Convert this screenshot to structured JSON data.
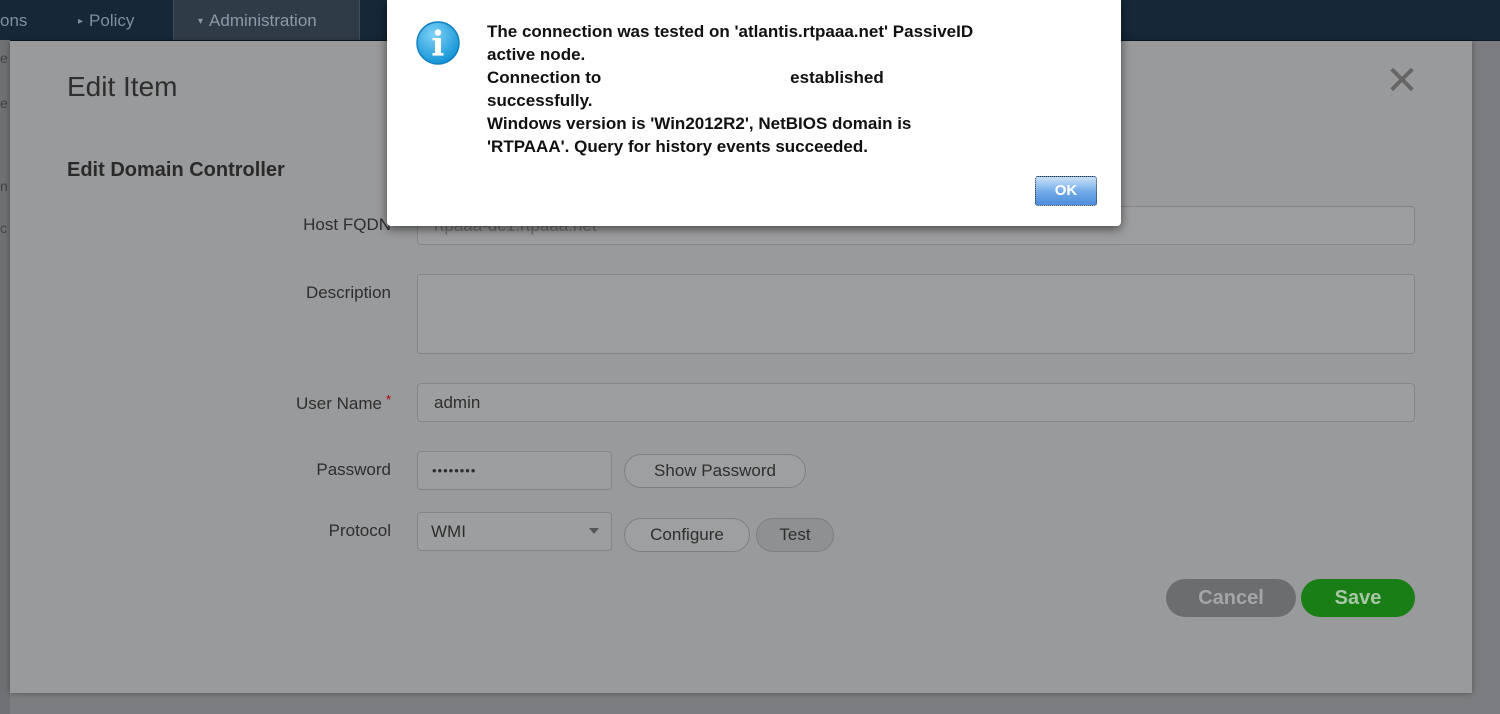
{
  "nav": {
    "items": [
      {
        "label": "ons",
        "caret": ""
      },
      {
        "label": "Policy",
        "caret": "▸"
      },
      {
        "label": "Administration",
        "caret": "▾"
      }
    ]
  },
  "side_letters": [
    "e",
    "e",
    "n",
    "c"
  ],
  "modal": {
    "title": "Edit Item",
    "close_glyph": "✕",
    "section_title": "Edit Domain Controller",
    "fields": {
      "host_fqdn": {
        "label": "Host FQDN",
        "value": "rtpaaa-dc1.rtpaaa.net"
      },
      "description": {
        "label": "Description",
        "value": ""
      },
      "user_name": {
        "label": "User Name",
        "required_mark": "*",
        "value": "admin"
      },
      "password": {
        "label": "Password",
        "value": "••••••••"
      },
      "protocol": {
        "label": "Protocol",
        "value": "WMI"
      }
    },
    "buttons": {
      "show_password": "Show Password",
      "configure": "Configure",
      "test": "Test",
      "cancel": "Cancel",
      "save": "Save"
    }
  },
  "alert": {
    "icon": "info-icon",
    "lines": [
      "The connection was tested on 'atlantis.rtpaaa.net' PassiveID",
      "active node.",
      "Connection to                                        established",
      "successfully.",
      "Windows version is 'Win2012R2', NetBIOS domain is",
      "'RTPAAA'. Query for history events succeeded."
    ],
    "ok_label": "OK"
  },
  "colors": {
    "accent_save": "#1a7e17",
    "info_blue": "#1aa3e0",
    "nav_bg": "#162838"
  }
}
